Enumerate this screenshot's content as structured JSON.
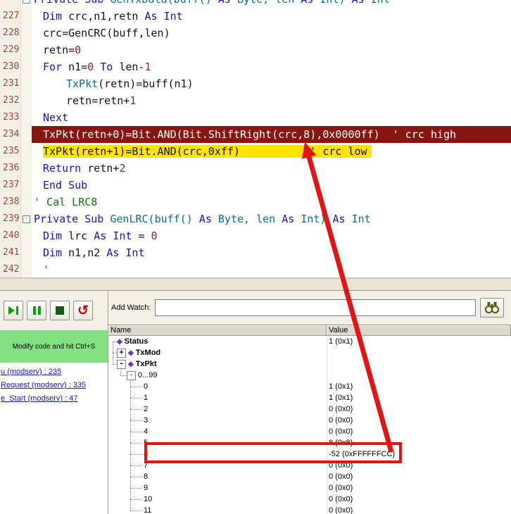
{
  "colors": {
    "keyword": "#1414c8",
    "identifier": "#141414",
    "number": "#a02020",
    "comment": "#007d00",
    "type_teal": "#007882",
    "exec_line_bg": "#871612",
    "selected_line_bg": "#ffe400",
    "annotation_red": "#e41414",
    "link": "#1414cc",
    "message_bg": "#82e082",
    "diamond_icon": "#7a2fc0"
  },
  "editor": {
    "lines": [
      {
        "no": "",
        "indent": 0,
        "fold": true,
        "seg": [
          [
            "kw",
            "Private Sub "
          ],
          [
            "ty",
            "GenTxData(buff() "
          ],
          [
            "kw",
            "As "
          ],
          [
            "ty",
            "Byte"
          ],
          [
            "ty",
            ", len "
          ],
          [
            "kw",
            "As "
          ],
          [
            "ty",
            "Int"
          ],
          [
            "ty",
            ") "
          ],
          [
            "kw",
            "As "
          ],
          [
            "ty",
            "Int"
          ]
        ]
      },
      {
        "no": "227",
        "indent": 1,
        "seg": [
          [
            "kw",
            "Dim "
          ],
          [
            "pl",
            "crc,n1,retn "
          ],
          [
            "kw",
            "As Int"
          ]
        ]
      },
      {
        "no": "228",
        "indent": 1,
        "seg": [
          [
            "pl",
            "crc=GenCRC(buff,len)"
          ]
        ]
      },
      {
        "no": "229",
        "indent": 1,
        "seg": [
          [
            "pl",
            "retn="
          ],
          [
            "num",
            "0"
          ]
        ]
      },
      {
        "no": "230",
        "indent": 1,
        "seg": [
          [
            "kw",
            "For "
          ],
          [
            "pl",
            "n1="
          ],
          [
            "num",
            "0"
          ],
          [
            "kw",
            " To "
          ],
          [
            "pl",
            "len-"
          ],
          [
            "num",
            "1"
          ]
        ]
      },
      {
        "no": "231",
        "indent": 2,
        "seg": [
          [
            "ty",
            "TxPkt"
          ],
          [
            "pl",
            "(retn)=buff(n1)"
          ]
        ]
      },
      {
        "no": "232",
        "indent": 2,
        "seg": [
          [
            "pl",
            "retn=retn+"
          ],
          [
            "num",
            "1"
          ]
        ]
      },
      {
        "no": "233",
        "indent": 1,
        "seg": [
          [
            "kw",
            "Next"
          ]
        ]
      },
      {
        "no": "234",
        "indent": 1,
        "hl": "exec",
        "seg": [
          [
            "wh",
            "TxPkt(retn+0)=Bit.AND(Bit.ShiftRight(crc,8),0x0000ff)  ' crc high"
          ]
        ]
      },
      {
        "no": "235",
        "indent": 1,
        "hl": "sel",
        "seg": [
          [
            "pl",
            "TxPkt(retn+1)=Bit.AND(crc,0xff)           "
          ],
          [
            "pl",
            "' crc low"
          ]
        ]
      },
      {
        "no": "236",
        "indent": 1,
        "seg": [
          [
            "kw",
            "Return "
          ],
          [
            "pl",
            "retn+"
          ],
          [
            "num",
            "2"
          ]
        ]
      },
      {
        "no": "237",
        "indent": 1,
        "seg": [
          [
            "kw",
            "End Sub"
          ]
        ]
      },
      {
        "no": "238",
        "indent": 0,
        "seg": [
          [
            "cm",
            "' Cal LRC8"
          ]
        ]
      },
      {
        "no": "239",
        "indent": 0,
        "fold": true,
        "seg": [
          [
            "kw",
            "Private Sub "
          ],
          [
            "ty",
            "GenLRC(buff() "
          ],
          [
            "kw",
            "As "
          ],
          [
            "ty",
            "Byte"
          ],
          [
            "ty",
            ", len "
          ],
          [
            "kw",
            "As "
          ],
          [
            "ty",
            "Int"
          ],
          [
            "ty",
            ") "
          ],
          [
            "kw",
            "As "
          ],
          [
            "ty",
            "Int"
          ]
        ]
      },
      {
        "no": "240",
        "indent": 1,
        "seg": [
          [
            "kw",
            "Dim "
          ],
          [
            "pl",
            "lrc "
          ],
          [
            "kw",
            "As Int"
          ],
          [
            "pl",
            " = "
          ],
          [
            "num",
            "0"
          ]
        ]
      },
      {
        "no": "241",
        "indent": 1,
        "seg": [
          [
            "kw",
            "Dim "
          ],
          [
            "pl",
            "n1,n2 "
          ],
          [
            "kw",
            "As Int"
          ]
        ]
      },
      {
        "no": "242",
        "indent": 1,
        "seg": [
          [
            "cm",
            "'"
          ]
        ]
      }
    ]
  },
  "debugger": {
    "toolbar": {
      "buttons": [
        {
          "name": "resume"
        },
        {
          "name": "pause"
        },
        {
          "name": "stop"
        },
        {
          "name": "restart",
          "glyph": "↺"
        }
      ]
    },
    "message": "Modify code and hit Ctrl+S",
    "links": [
      "u (modserv) : 235",
      "Request (modserv) : 335",
      "e_Start (modserv) : 47"
    ],
    "watch": {
      "add_watch_label": "Add Watch:",
      "input_value": "",
      "columns": [
        "Name",
        "Value"
      ],
      "rows": [
        {
          "name": "Status",
          "value": "1 (0x1)",
          "kind": "var",
          "expander": null
        },
        {
          "name": "TxMod",
          "value": "",
          "kind": "var",
          "expander": "+"
        },
        {
          "name": "TxPkt",
          "value": "",
          "kind": "var",
          "expander": "-"
        },
        {
          "name": "0...99",
          "value": "",
          "kind": "range",
          "expander": "-"
        },
        {
          "name": "0",
          "value": "1 (0x1)",
          "kind": "item"
        },
        {
          "name": "1",
          "value": "1 (0x1)",
          "kind": "item"
        },
        {
          "name": "2",
          "value": "0 (0x0)",
          "kind": "item"
        },
        {
          "name": "3",
          "value": "0 (0x0)",
          "kind": "item"
        },
        {
          "name": "4",
          "value": "0 (0x0)",
          "kind": "item"
        },
        {
          "name": "5",
          "value": "8 (0x8)",
          "kind": "item"
        },
        {
          "name": "6",
          "value": "-52 (0xFFFFFFCC)",
          "kind": "item",
          "highlight": true
        },
        {
          "name": "7",
          "value": "0 (0x0)",
          "kind": "item"
        },
        {
          "name": "8",
          "value": "0 (0x0)",
          "kind": "item"
        },
        {
          "name": "9",
          "value": "0 (0x0)",
          "kind": "item"
        },
        {
          "name": "10",
          "value": "0 (0x0)",
          "kind": "item"
        },
        {
          "name": "11",
          "value": "0 (0x0)",
          "kind": "item"
        }
      ]
    }
  }
}
